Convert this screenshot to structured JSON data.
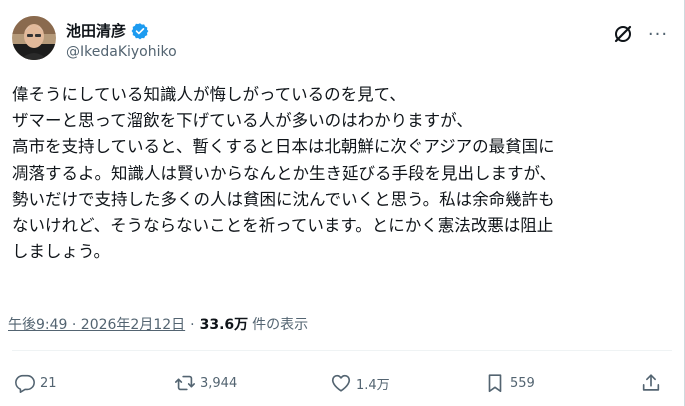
{
  "author": {
    "display_name": "池田清彦",
    "handle": "@IkedaKiyohiko",
    "verified": true,
    "avatar": "avatar-photo"
  },
  "header_icons": [
    "grok-icon",
    "more-icon"
  ],
  "more_label": "···",
  "tweet": {
    "lines": [
      "偉そうにしている知識人が悔しがっているのを見て、",
      "ザマーと思って溜飲を下げている人が多いのはわかりますが、",
      "高市を支持していると、暫くすると日本は北朝鮮に次ぐアジアの最貧国に",
      "凋落するよ。知識人は賢いからなんとか生き延びる手段を見出しますが、",
      "勢いだけで支持した多くの人は貧困に沈んでいくと思う。私は余命幾許も",
      "ないけれど、そうならないことを祈っています。とにかく憲法改悪は阻止",
      "しましょう。"
    ]
  },
  "meta": {
    "timestamp": "午後9:49 · 2026年2月12日",
    "separator": "·",
    "views_count": "33.6万",
    "views_label": "件の表示"
  },
  "actions": {
    "replies": "21",
    "reposts": "3,944",
    "likes": "1.4万",
    "bookmarks": "559"
  },
  "colors": {
    "text": "#0f1419",
    "secondary": "#536471",
    "verified": "#1d9bf0",
    "border": "#cfd9de"
  }
}
